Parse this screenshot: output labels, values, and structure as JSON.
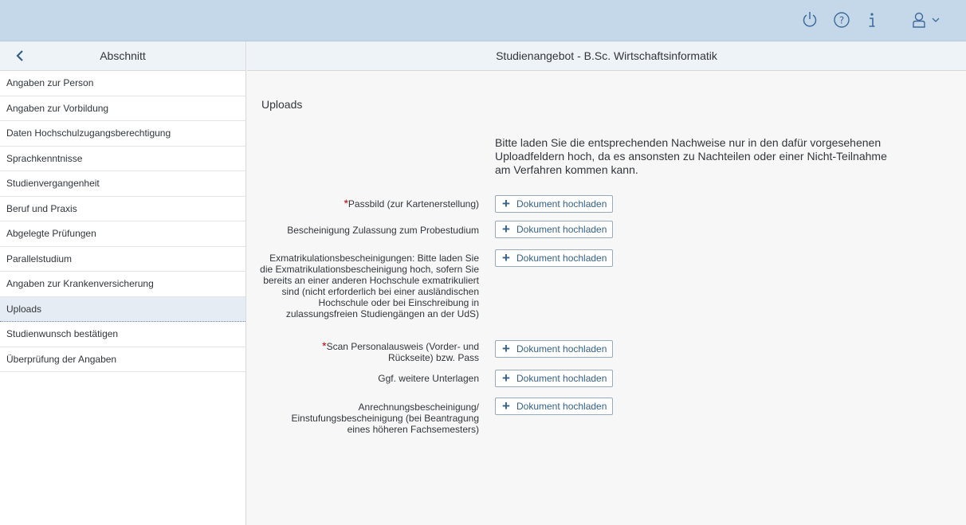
{
  "sidebar": {
    "title": "Abschnitt",
    "items": [
      "Angaben zur Person",
      "Angaben zur Vorbildung",
      "Daten Hochschulzugangsberechtigung",
      "Sprachkenntnisse",
      "Studienvergangenheit",
      "Beruf und Praxis",
      "Abgelegte Prüfungen",
      "Parallelstudium",
      "Angaben zur Krankenversicherung",
      "Uploads",
      "Studienwunsch bestätigen",
      "Überprüfung der Angaben"
    ],
    "active_index": 9
  },
  "main": {
    "title": "Studienangebot - B.Sc. Wirtschaftsinformatik",
    "section_title": "Uploads",
    "intro": "Bitte laden Sie die entsprechenden Nachweise nur in den dafür vorgesehenen Uploadfeldern hoch, da es ansonsten zu Nachteilen oder einer Nicht-Teilnahme am Verfahren kommen kann.",
    "required_marker": "*",
    "uploads": [
      {
        "label": "Passbild (zur Kartenerstellung)",
        "required": true,
        "button": "Dokument hochladen"
      },
      {
        "label": "Bescheinigung Zulassung zum Probestudium",
        "required": false,
        "button": "Dokument hochladen"
      },
      {
        "label": "Exmatrikulationsbescheinigungen: Bitte laden Sie die Exmatrikulationsbescheinigung hoch, sofern Sie bereits an einer anderen Hochschule exmatrikuliert sind (nicht erforderlich bei einer ausländischen Hochschule oder bei Einschreibung in zulassungsfreien Studiengängen an der UdS)",
        "required": false,
        "button": "Dokument hochladen"
      },
      {
        "label": "Scan Personalausweis (Vorder- und Rückseite) bzw. Pass",
        "required": true,
        "button": "Dokument hochladen"
      },
      {
        "label": "Ggf. weitere Unterlagen",
        "required": false,
        "button": "Dokument hochladen"
      },
      {
        "label": "Anrechnungsbescheinigung/ Einstufungsbescheinigung (bei Beantragung eines höheren Fachsemesters)",
        "required": false,
        "button": "Dokument hochladen"
      }
    ]
  },
  "topbar": {
    "icons": [
      "power-icon",
      "help-icon",
      "info-icon",
      "user-icon",
      "chevron-down-icon"
    ],
    "icon_color": "#3d6a9a"
  },
  "colors": {
    "header_bg": "#c5d8ea",
    "active_item_bg": "#e5ecf3",
    "required": "#bb0000"
  }
}
